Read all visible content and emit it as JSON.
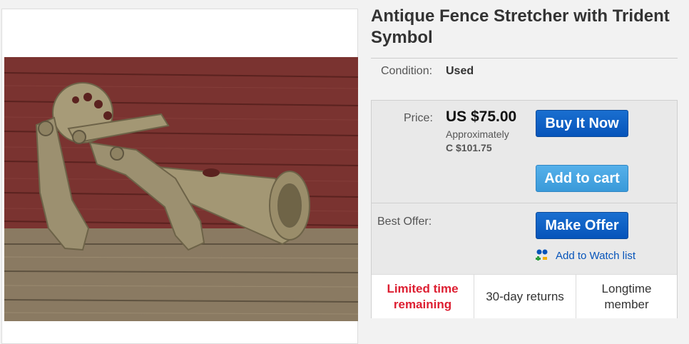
{
  "listing": {
    "title": "Antique Fence Stretcher with Trident Symbol",
    "condition_label": "Condition:",
    "condition_value": "Used",
    "image_alt": "Rusty antique fence stretcher tool resting on a wooden deck against a red wood wall"
  },
  "pricing": {
    "price_label": "Price:",
    "price_value": "US $75.00",
    "approx_label": "Approximately",
    "approx_value": "C $101.75"
  },
  "actions": {
    "buy_now": "Buy It Now",
    "add_to_cart": "Add to cart",
    "best_offer_label": "Best Offer:",
    "make_offer": "Make Offer",
    "watch": "Add to Watch list"
  },
  "badges": [
    {
      "line1": "Limited time",
      "line2": "remaining"
    },
    {
      "line1": "30-day returns",
      "line2": ""
    },
    {
      "line1": "Longtime",
      "line2": "member"
    }
  ],
  "colors": {
    "primary_button": "#0654ba",
    "secondary_button": "#3a9ad9",
    "urgent_text": "#dd1e31",
    "link": "#0654ba"
  },
  "icons": {
    "watch": "watch-list-icon"
  }
}
